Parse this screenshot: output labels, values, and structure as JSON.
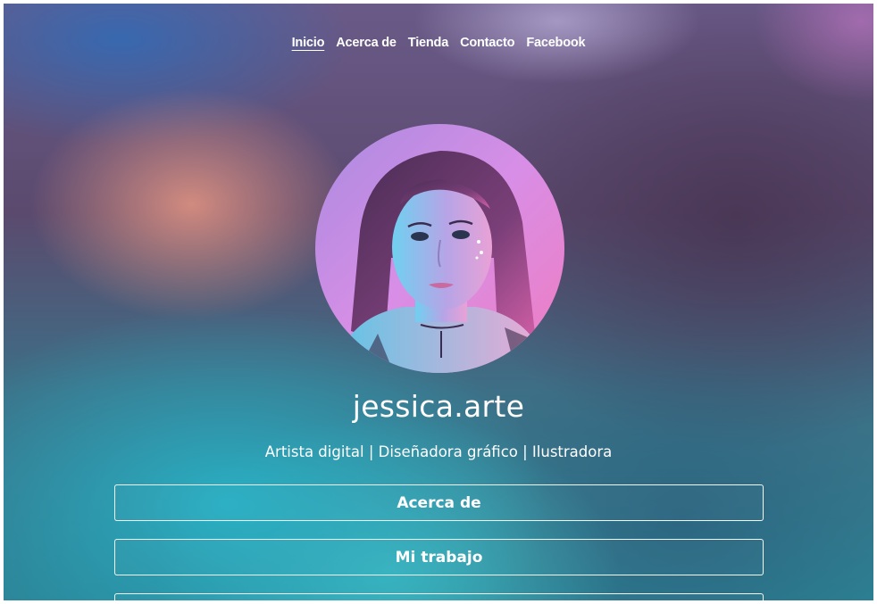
{
  "nav": {
    "items": [
      {
        "label": "Inicio",
        "active": true
      },
      {
        "label": "Acerca de",
        "active": false
      },
      {
        "label": "Tienda",
        "active": false
      },
      {
        "label": "Contacto",
        "active": false
      },
      {
        "label": "Facebook",
        "active": false
      }
    ]
  },
  "profile": {
    "avatar": "profile-photo",
    "username": "jessica.arte",
    "tagline": "Artista digital | Diseñadora gráfico | Ilustradora"
  },
  "links": [
    {
      "label": "Acerca de"
    },
    {
      "label": "Mi trabajo"
    },
    {
      "label": ""
    }
  ],
  "colors": {
    "text": "#ffffff",
    "background_top": "#5b4a6e",
    "background_bottom": "#2c7f92",
    "accent_pink": "#e0789a",
    "accent_teal": "#2fb6c6"
  }
}
